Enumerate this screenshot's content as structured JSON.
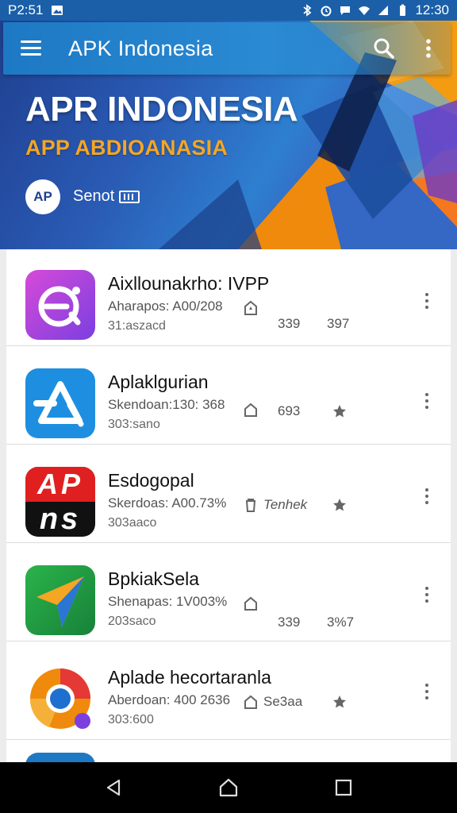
{
  "status_bar": {
    "left_text": "P2:51",
    "time": "12:30"
  },
  "app_bar": {
    "title": "APK Indonesia"
  },
  "hero": {
    "title": "APR INDONESIA",
    "subtitle": "APP ABDIOANASIA",
    "logo_text": "AP",
    "user_text": "Senot"
  },
  "apps": [
    {
      "name": "Aixllounakrho: IVPP",
      "meta": "Aharapos: A00/208",
      "size": "31:aszacd",
      "stat_a": "339",
      "stat_b": "397"
    },
    {
      "name": "Aplaklgurian",
      "meta": "Skendoan:130: 368",
      "size": "303:sano",
      "stat_a": "693",
      "stat_b": ""
    },
    {
      "name": "Esdogopal",
      "meta": "Skerdoas: A00.73%",
      "size": "303aaco",
      "stat_a": "Tenhek",
      "stat_b": ""
    },
    {
      "name": "BpkiakSela",
      "meta": "Shenapas: 1V003%",
      "size": "203saco",
      "stat_a": "339",
      "stat_b": "3%7"
    },
    {
      "name": "Aplade hecortaranla",
      "meta": "Aberdoan: 400 2636",
      "size": "303:600",
      "stat_a": "Se3aa",
      "stat_b": ""
    }
  ],
  "icon_2_text": {
    "top": "AP",
    "bottom": "ns"
  },
  "colors": {
    "app_bar": "#2a8ad3",
    "accent_orange": "#f5a623",
    "nav_bar": "#000000"
  }
}
